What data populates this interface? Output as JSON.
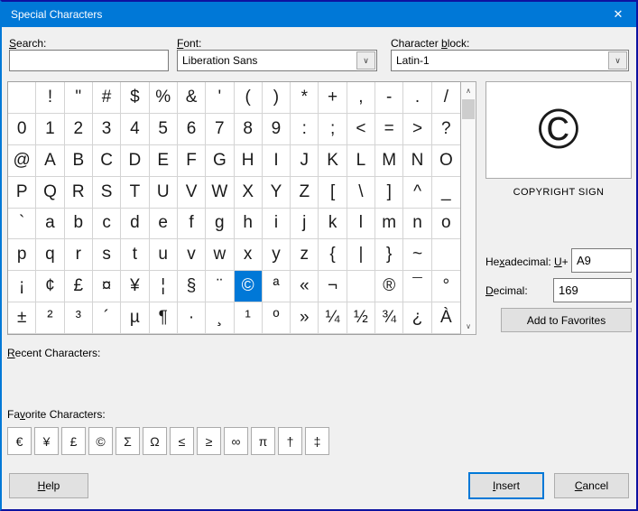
{
  "window": {
    "title": "Special Characters"
  },
  "colors": {
    "accent": "#0078D7",
    "selection_bg": "#0078D7",
    "titlebar_bg": "#0078D7",
    "window_border": "#0D12A0",
    "dialog_bg": "#F0F0F0"
  },
  "icons": {
    "close": "✕",
    "chevron_down": "∨",
    "scroll_up": "∧",
    "scroll_down": "∨"
  },
  "toolbar": {
    "search": {
      "label": {
        "text": "Search:",
        "accel": 0
      },
      "value": ""
    },
    "font": {
      "label": {
        "text": "Font:",
        "accel": 0
      },
      "value": "Liberation Sans"
    },
    "block": {
      "label": {
        "text": "Character block:",
        "accel": 10
      },
      "value": "Latin-1"
    }
  },
  "char_grid": {
    "selected": {
      "row": 6,
      "col": 8
    },
    "rows": [
      [
        " ",
        "!",
        "\"",
        "#",
        "$",
        "%",
        "&",
        "'",
        "(",
        ")",
        "*",
        "+",
        ",",
        "-",
        ".",
        "/"
      ],
      [
        "0",
        "1",
        "2",
        "3",
        "4",
        "5",
        "6",
        "7",
        "8",
        "9",
        ":",
        ";",
        "<",
        "=",
        ">",
        "?"
      ],
      [
        "@",
        "A",
        "B",
        "C",
        "D",
        "E",
        "F",
        "G",
        "H",
        "I",
        "J",
        "K",
        "L",
        "M",
        "N",
        "O"
      ],
      [
        "P",
        "Q",
        "R",
        "S",
        "T",
        "U",
        "V",
        "W",
        "X",
        "Y",
        "Z",
        "[",
        "\\",
        "]",
        "^",
        "_"
      ],
      [
        "`",
        "a",
        "b",
        "c",
        "d",
        "e",
        "f",
        "g",
        "h",
        "i",
        "j",
        "k",
        "l",
        "m",
        "n",
        "o"
      ],
      [
        "p",
        "q",
        "r",
        "s",
        "t",
        "u",
        "v",
        "w",
        "x",
        "y",
        "z",
        "{",
        "|",
        "}",
        "~",
        ""
      ],
      [
        "¡",
        "¢",
        "£",
        "¤",
        "¥",
        "¦",
        "§",
        "¨",
        "©",
        "ª",
        "«",
        "¬",
        "",
        "®",
        "¯",
        "°"
      ],
      [
        "±",
        "²",
        "³",
        "´",
        "µ",
        "¶",
        "·",
        "¸",
        "¹",
        "º",
        "»",
        "¼",
        "½",
        "¾",
        "¿",
        "À"
      ]
    ]
  },
  "preview": {
    "character": "©",
    "name": "COPYRIGHT SIGN"
  },
  "details": {
    "hex": {
      "label": {
        "text": "Hexadecimal:",
        "accel": 2
      },
      "prefix": {
        "text": "U+",
        "accel": 0
      },
      "value": "A9"
    },
    "decimal": {
      "label": {
        "text": "Decimal:",
        "accel": 0
      },
      "value": "169"
    },
    "add_favorites": {
      "text": "Add to Favorites",
      "accel": -1
    }
  },
  "recent": {
    "label": {
      "text": "Recent Characters:",
      "accel": 0
    },
    "chars": []
  },
  "favorites": {
    "label": {
      "text": "Favorite Characters:",
      "accel": 2
    },
    "chars": [
      "€",
      "¥",
      "£",
      "©",
      "Σ",
      "Ω",
      "≤",
      "≥",
      "∞",
      "π",
      "†",
      "‡"
    ]
  },
  "footer": {
    "help": {
      "text": "Help",
      "accel": 0
    },
    "insert": {
      "text": "Insert",
      "accel": 0
    },
    "cancel": {
      "text": "Cancel",
      "accel": 0
    }
  }
}
